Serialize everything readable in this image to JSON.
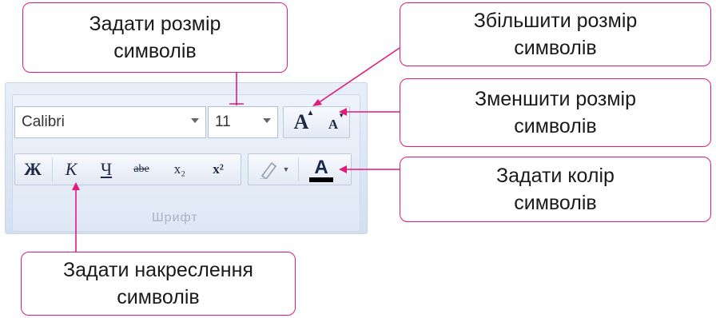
{
  "ribbon": {
    "font_name": "Calibri",
    "font_size": "11",
    "group_label": "Шрифт",
    "bold_label": "Ж",
    "italic_label": "К",
    "underline_label": "Ч",
    "strike_label": "abe",
    "subscript_label": "x₂",
    "superscript_label": "x²",
    "grow_label": "A",
    "shrink_label": "A",
    "font_color_label": "A"
  },
  "callouts": {
    "set_size": {
      "line1": "Задати розмір",
      "line2": "символів"
    },
    "grow_size": {
      "line1": "Збільшити розмір",
      "line2": "символів"
    },
    "shrink_size": {
      "line1": "Зменшити розмір",
      "line2": "символів"
    },
    "font_color": {
      "line1": "Задати колір",
      "line2": "символів"
    },
    "font_style": {
      "line1": "Задати накреслення",
      "line2": "символів"
    }
  },
  "colors": {
    "accent": "#e21a7c",
    "font_color_bar": "#000000"
  }
}
